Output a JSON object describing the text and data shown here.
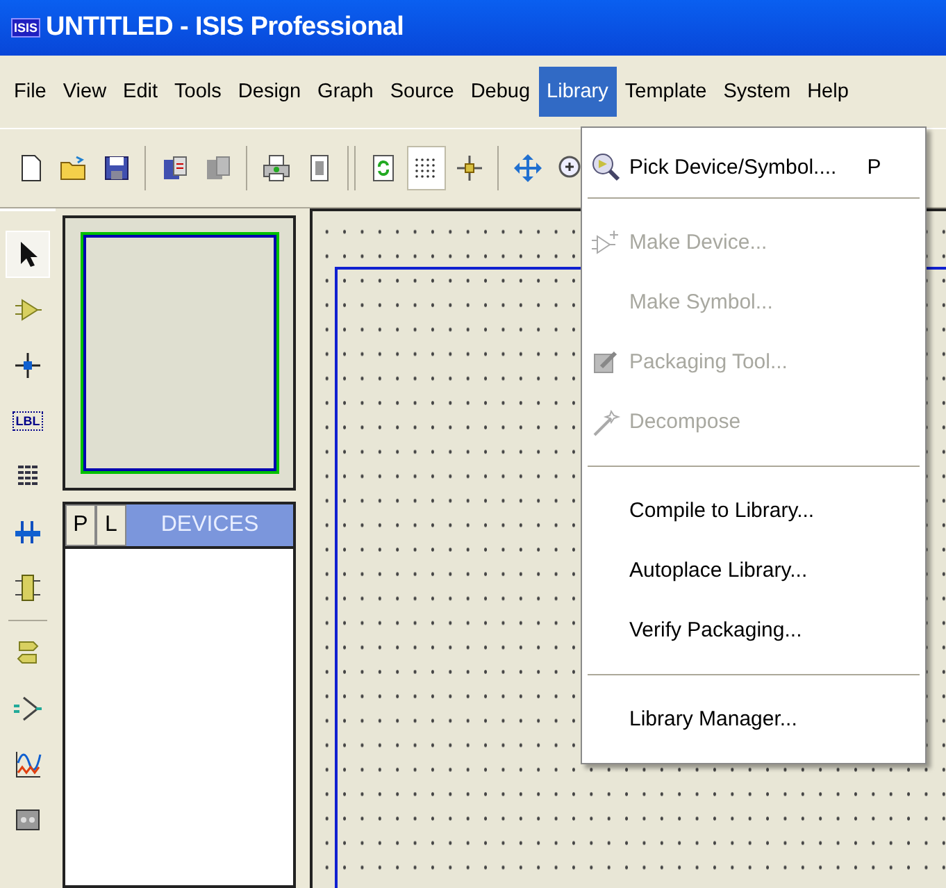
{
  "window": {
    "title": "UNTITLED - ISIS Professional",
    "app_badge": "ISIS"
  },
  "menu_bar": [
    {
      "label": "File",
      "selected": false
    },
    {
      "label": "View",
      "selected": false
    },
    {
      "label": "Edit",
      "selected": false
    },
    {
      "label": "Tools",
      "selected": false
    },
    {
      "label": "Design",
      "selected": false
    },
    {
      "label": "Graph",
      "selected": false
    },
    {
      "label": "Source",
      "selected": false
    },
    {
      "label": "Debug",
      "selected": false
    },
    {
      "label": "Library",
      "selected": true
    },
    {
      "label": "Template",
      "selected": false
    },
    {
      "label": "System",
      "selected": false
    },
    {
      "label": "Help",
      "selected": false
    }
  ],
  "toolbar": [
    {
      "kind": "new",
      "pressed": false
    },
    {
      "kind": "open",
      "pressed": false
    },
    {
      "kind": "save",
      "pressed": false
    },
    {
      "kind": "sep"
    },
    {
      "kind": "import",
      "pressed": false
    },
    {
      "kind": "export",
      "pressed": false
    },
    {
      "kind": "sep"
    },
    {
      "kind": "print",
      "pressed": false
    },
    {
      "kind": "page",
      "pressed": false
    },
    {
      "kind": "bigsep"
    },
    {
      "kind": "refresh",
      "pressed": false
    },
    {
      "kind": "grid",
      "pressed": true
    },
    {
      "kind": "origin",
      "pressed": false
    },
    {
      "kind": "sep"
    },
    {
      "kind": "pan",
      "pressed": false
    },
    {
      "kind": "zoom",
      "pressed": false
    }
  ],
  "left_toolbar": [
    {
      "kind": "pointer",
      "selected": true
    },
    {
      "kind": "component",
      "selected": false
    },
    {
      "kind": "junction",
      "selected": false
    },
    {
      "kind": "label",
      "text": "LBL",
      "selected": false
    },
    {
      "kind": "script",
      "selected": false
    },
    {
      "kind": "bus",
      "selected": false
    },
    {
      "kind": "subcircuit",
      "selected": false
    },
    {
      "kind": "sep"
    },
    {
      "kind": "terminal",
      "selected": false
    },
    {
      "kind": "port",
      "selected": false
    },
    {
      "kind": "graph",
      "selected": false
    },
    {
      "kind": "tape",
      "selected": false
    }
  ],
  "devices_panel": {
    "buttons": [
      "P",
      "L"
    ],
    "title": "DEVICES"
  },
  "library_menu": [
    {
      "kind": "item",
      "label": "Pick Device/Symbol....",
      "shortcut": "P",
      "disabled": false
    },
    {
      "kind": "separator"
    },
    {
      "kind": "item",
      "label": "Make Device...",
      "disabled": true
    },
    {
      "kind": "item",
      "label": "Make Symbol...",
      "disabled": true
    },
    {
      "kind": "item",
      "label": "Packaging Tool...",
      "disabled": true
    },
    {
      "kind": "item",
      "label": "Decompose",
      "disabled": true
    },
    {
      "kind": "separator"
    },
    {
      "kind": "item",
      "label": "Compile to Library...",
      "disabled": false
    },
    {
      "kind": "item",
      "label": "Autoplace Library...",
      "disabled": false
    },
    {
      "kind": "item",
      "label": "Verify Packaging...",
      "disabled": false
    },
    {
      "kind": "separator"
    },
    {
      "kind": "item",
      "label": "Library Manager...",
      "disabled": false
    }
  ]
}
